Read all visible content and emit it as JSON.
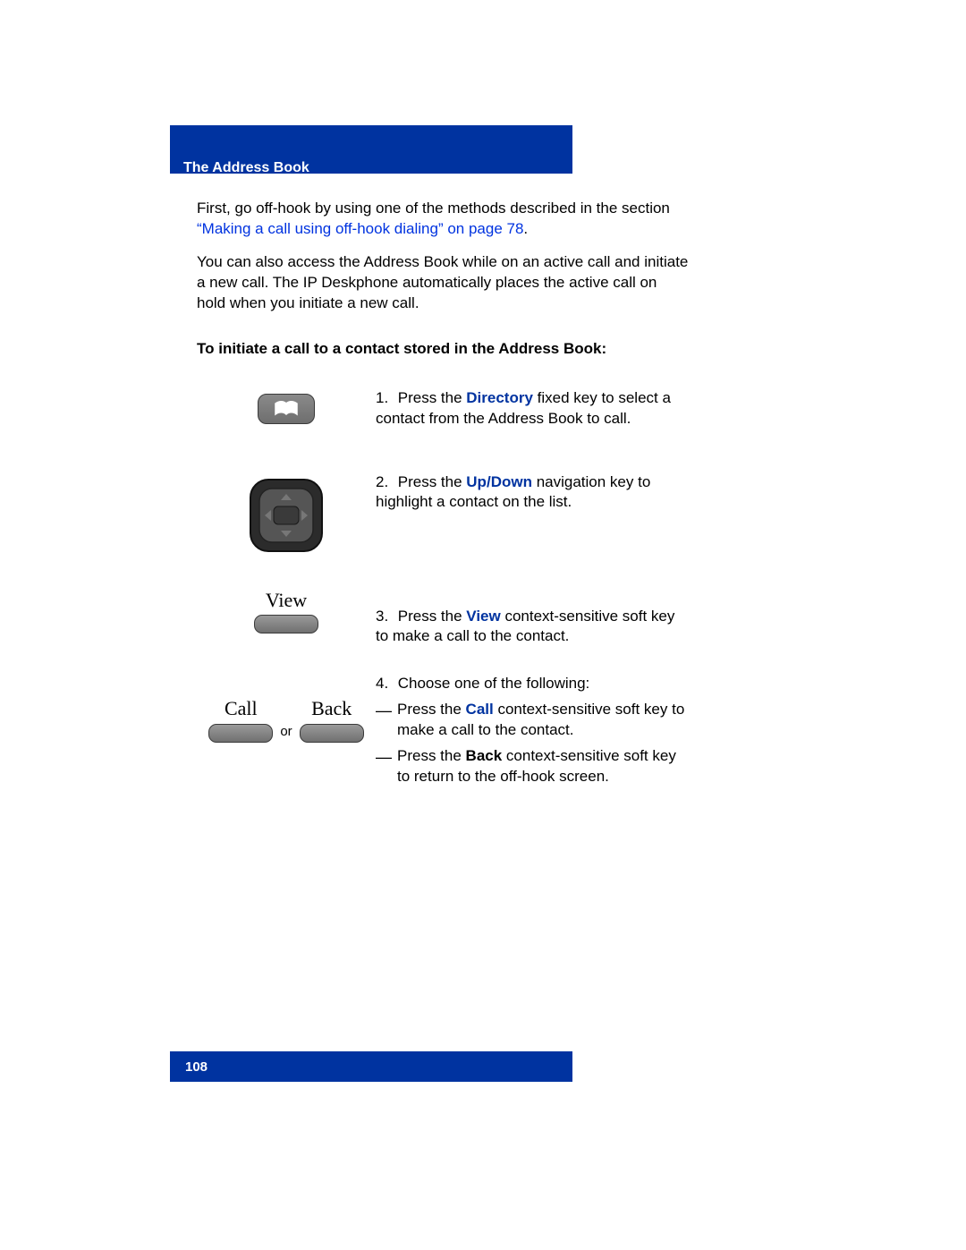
{
  "header": "The Address Book",
  "intro1": "First, go off-hook by using one of the methods described in the section ",
  "link1": "“Making a call using off-hook dialing” on page 78",
  "intro1_end": ".",
  "intro2": "You can also access the Address Book while on an active call and initiate a new call. The IP Deskphone automatically places the active call on hold when you initiate a new call.",
  "subhead": "To initiate a call to a contact stored in the Address Book:",
  "step1_num": "1.",
  "step1_a": "Press the ",
  "step1_kw": "Directory",
  "step1_b": " fixed key to select a contact from the Address Book to call.",
  "step2_num": "2.",
  "step2_a": "Press the ",
  "step2_kw1": "Up",
  "step2_sep": "/",
  "step2_kw2": "Down",
  "step2_b": " navigation key to highlight a contact on the list.",
  "view_label": "View",
  "step3_num": "3.",
  "step3_a": "Press the ",
  "step3_kw": "View",
  "step3_b": " context-sensitive soft key to make a call to the contact.",
  "call_label": "Call",
  "back_label": "Back",
  "or_text": "or",
  "step4_num": "4.",
  "step4_a": "Choose one of the following:",
  "dash": "—",
  "opt1_a": "Press the ",
  "opt1_kw": "Call",
  "opt1_b": " context-sensitive soft key to make a call to the contact.",
  "opt2_a": "Press the ",
  "opt2_kw": "Back",
  "opt2_b": " context-sensitive soft key to return to the off-hook screen.",
  "page_num": "108"
}
